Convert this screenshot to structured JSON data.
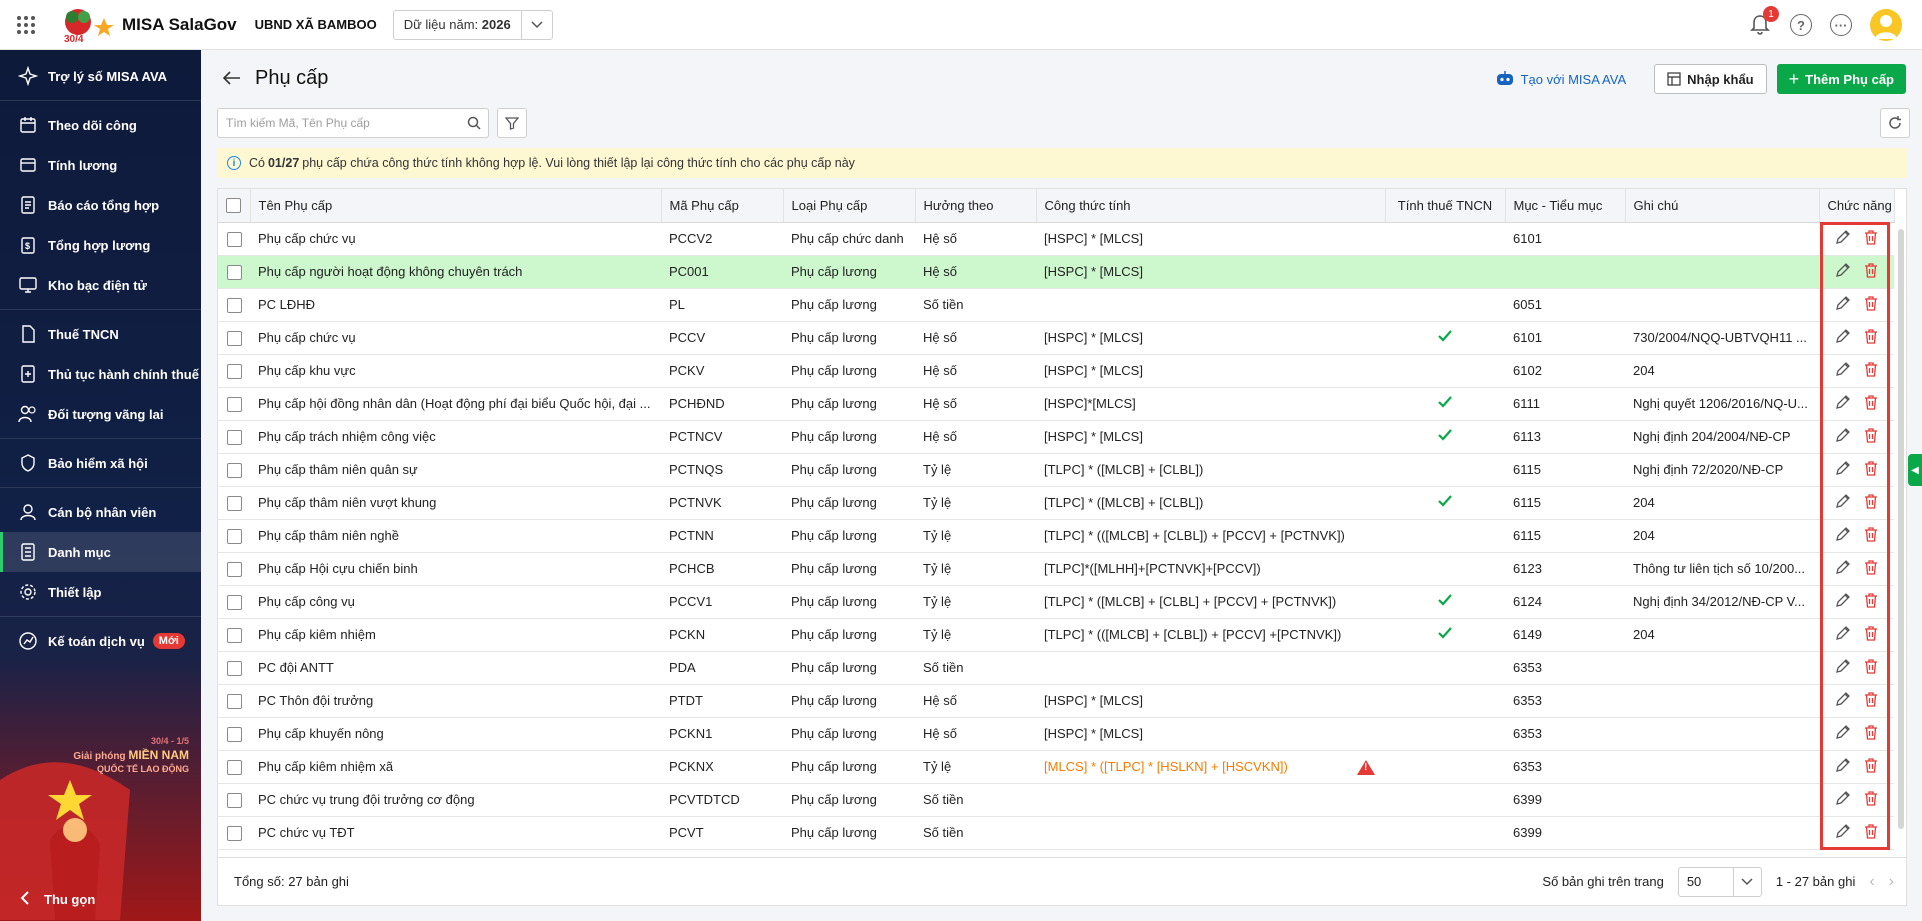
{
  "topbar": {
    "app_name": "MISA SalaGov",
    "org_name": "UBND XÃ BAMBOO",
    "year_label": "Dữ liệu năm:",
    "year_value": "2026",
    "notification_count": "1",
    "logo_text": "30/4"
  },
  "sidebar": {
    "items": [
      {
        "label": "Trợ lý số MISA AVA",
        "icon": "sparkle-icon"
      },
      {
        "label": "Theo dõi công",
        "icon": "calendar-icon"
      },
      {
        "label": "Tính lương",
        "icon": "calculator-icon"
      },
      {
        "label": "Báo cáo tổng hợp",
        "icon": "report-icon"
      },
      {
        "label": "Tổng hợp lương",
        "icon": "salary-summary-icon"
      },
      {
        "label": "Kho bạc điện tử",
        "icon": "monitor-icon"
      },
      {
        "label": "Thuế TNCN",
        "icon": "tax-icon"
      },
      {
        "label": "Thủ tục hành chính thuế",
        "icon": "tax-procedure-icon"
      },
      {
        "label": "Đối tượng vãng lai",
        "icon": "users-icon"
      },
      {
        "label": "Bảo hiểm xã hội",
        "icon": "shield-icon"
      },
      {
        "label": "Cán bộ nhân viên",
        "icon": "staff-icon"
      },
      {
        "label": "Danh mục",
        "icon": "list-icon"
      },
      {
        "label": "Thiết lập",
        "icon": "gear-icon"
      },
      {
        "label": "Kế toán dịch vụ",
        "icon": "accounting-icon"
      }
    ],
    "new_badge": "Mới",
    "collapse_label": "Thu gọn",
    "poster": {
      "date": "30/4 - 1/5",
      "line1": "Giải phóng",
      "line1_bold": "MIỀN NAM",
      "line2": "QUỐC TẾ LAO ĐỘNG"
    }
  },
  "page": {
    "title": "Phụ cấp",
    "ava_link": "Tạo với MISA AVA",
    "import_label": "Nhập khẩu",
    "add_label": "Thêm Phụ cấp",
    "search_placeholder": "Tìm kiếm Mã, Tên Phụ cấp",
    "warning": {
      "prefix": "Có",
      "count": "01/27",
      "suffix": "phụ cấp chứa công thức tính không hợp lệ. Vui lòng thiết lập lại công thức tính cho các phụ cấp này"
    }
  },
  "table": {
    "columns": [
      "Tên Phụ cấp",
      "Mã Phụ cấp",
      "Loại Phụ cấp",
      "Hưởng theo",
      "Công thức tính",
      "Tính thuế TNCN",
      "Mục - Tiểu mục",
      "Ghi chú",
      "Chức năng"
    ],
    "rows": [
      {
        "name": "Phụ cấp chức vụ",
        "code": "PCCV2",
        "type": "Phụ cấp chức danh",
        "basis": "Hệ số",
        "formula": "[HSPC] * [MLCS]",
        "tax": false,
        "item": "6101",
        "note": "",
        "invalid": false,
        "highlight": false
      },
      {
        "name": "Phụ cấp người hoạt động không chuyên trách",
        "code": "PC001",
        "type": "Phụ cấp lương",
        "basis": "Hệ số",
        "formula": "[HSPC] * [MLCS]",
        "tax": false,
        "item": "",
        "note": "",
        "invalid": false,
        "highlight": true
      },
      {
        "name": "PC LĐHĐ",
        "code": "PL",
        "type": "Phụ cấp lương",
        "basis": "Số tiền",
        "formula": "",
        "tax": false,
        "item": "6051",
        "note": "",
        "invalid": false,
        "highlight": false
      },
      {
        "name": "Phụ cấp chức vụ",
        "code": "PCCV",
        "type": "Phụ cấp lương",
        "basis": "Hệ số",
        "formula": "[HSPC] * [MLCS]",
        "tax": true,
        "item": "6101",
        "note": "730/2004/NQQ-UBTVQH11 ...",
        "invalid": false,
        "highlight": false
      },
      {
        "name": "Phụ cấp khu vực",
        "code": "PCKV",
        "type": "Phụ cấp lương",
        "basis": "Hệ số",
        "formula": "[HSPC] * [MLCS]",
        "tax": false,
        "item": "6102",
        "note": "204",
        "invalid": false,
        "highlight": false
      },
      {
        "name": "Phụ cấp hội đồng nhân dân (Hoạt động phí đại biểu Quốc hội, đại ...",
        "code": "PCHĐND",
        "type": "Phụ cấp lương",
        "basis": "Hệ số",
        "formula": "[HSPC]*[MLCS]",
        "tax": true,
        "item": "6111",
        "note": "Nghị quyết 1206/2016/NQ-U...",
        "invalid": false,
        "highlight": false
      },
      {
        "name": "Phụ cấp trách nhiệm công việc",
        "code": "PCTNCV",
        "type": "Phụ cấp lương",
        "basis": "Hệ số",
        "formula": "[HSPC] * [MLCS]",
        "tax": true,
        "item": "6113",
        "note": "Nghị định 204/2004/NĐ-CP",
        "invalid": false,
        "highlight": false
      },
      {
        "name": "Phụ cấp thâm niên quân sự",
        "code": "PCTNQS",
        "type": "Phụ cấp lương",
        "basis": "Tỷ lệ",
        "formula": "[TLPC] * ([MLCB] + [CLBL])",
        "tax": false,
        "item": "6115",
        "note": "Nghị định 72/2020/NĐ-CP",
        "invalid": false,
        "highlight": false
      },
      {
        "name": "Phụ cấp thâm niên vượt khung",
        "code": "PCTNVK",
        "type": "Phụ cấp lương",
        "basis": "Tỷ lệ",
        "formula": "[TLPC] * ([MLCB] + [CLBL])",
        "tax": true,
        "item": "6115",
        "note": "204",
        "invalid": false,
        "highlight": false
      },
      {
        "name": "Phụ cấp thâm niên nghề",
        "code": "PCTNN",
        "type": "Phụ cấp lương",
        "basis": "Tỷ lệ",
        "formula": "[TLPC] * (([MLCB] + [CLBL]) + [PCCV] + [PCTNVK])",
        "tax": false,
        "item": "6115",
        "note": "204",
        "invalid": false,
        "highlight": false
      },
      {
        "name": "Phụ cấp Hội cựu chiến binh",
        "code": "PCHCB",
        "type": "Phụ cấp lương",
        "basis": "Tỷ lệ",
        "formula": "[TLPC]*([MLHH]+[PCTNVK]+[PCCV])",
        "tax": false,
        "item": "6123",
        "note": "Thông tư liên tịch số 10/200...",
        "invalid": false,
        "highlight": false
      },
      {
        "name": "Phụ cấp công vụ",
        "code": "PCCV1",
        "type": "Phụ cấp lương",
        "basis": "Tỷ lệ",
        "formula": "[TLPC] * ([MLCB] + [CLBL] + [PCCV] + [PCTNVK])",
        "tax": true,
        "item": "6124",
        "note": "Nghị định 34/2012/NĐ-CP V...",
        "invalid": false,
        "highlight": false
      },
      {
        "name": "Phụ cấp kiêm nhiệm",
        "code": "PCKN",
        "type": "Phụ cấp lương",
        "basis": "Tỷ lệ",
        "formula": "[TLPC] * (([MLCB] + [CLBL]) + [PCCV] +[PCTNVK])",
        "tax": true,
        "item": "6149",
        "note": "204",
        "invalid": false,
        "highlight": false
      },
      {
        "name": "PC đội ANTT",
        "code": "PDA",
        "type": "Phụ cấp lương",
        "basis": "Số tiền",
        "formula": "",
        "tax": false,
        "item": "6353",
        "note": "",
        "invalid": false,
        "highlight": false
      },
      {
        "name": "PC Thôn đội trưởng",
        "code": "PTDT",
        "type": "Phụ cấp lương",
        "basis": "Hệ số",
        "formula": "[HSPC] * [MLCS]",
        "tax": false,
        "item": "6353",
        "note": "",
        "invalid": false,
        "highlight": false
      },
      {
        "name": "Phụ cấp khuyến nông",
        "code": "PCKN1",
        "type": "Phụ cấp lương",
        "basis": "Hệ số",
        "formula": "[HSPC] * [MLCS]",
        "tax": false,
        "item": "6353",
        "note": "",
        "invalid": false,
        "highlight": false
      },
      {
        "name": "Phụ cấp kiêm nhiệm xã",
        "code": "PCKNX",
        "type": "Phụ cấp lương",
        "basis": "Tỷ lệ",
        "formula": "[MLCS] * ([TLPC] * [HSLKN] + [HSCVKN])",
        "tax": false,
        "item": "6353",
        "note": "",
        "invalid": true,
        "highlight": false
      },
      {
        "name": "PC chức vụ trung đội trưởng cơ động",
        "code": "PCVTDTCD",
        "type": "Phụ cấp lương",
        "basis": "Số tiền",
        "formula": "",
        "tax": false,
        "item": "6399",
        "note": "",
        "invalid": false,
        "highlight": false
      },
      {
        "name": "PC chức vụ TĐT",
        "code": "PCVT",
        "type": "Phụ cấp lương",
        "basis": "Số tiền",
        "formula": "",
        "tax": false,
        "item": "6399",
        "note": "",
        "invalid": false,
        "highlight": false
      }
    ]
  },
  "footer": {
    "total": "Tổng số: 27 bản ghi",
    "page_size_label": "Số bản ghi trên trang",
    "page_size": "50",
    "range": "1 - 27 bản ghi"
  },
  "colors": {
    "accent": "#0ba84a",
    "highlight_row": "#cdf7cd",
    "error": "#e53935",
    "warning_bg": "#fdf7d2",
    "sidebar_bg": "#0e1a3a"
  }
}
